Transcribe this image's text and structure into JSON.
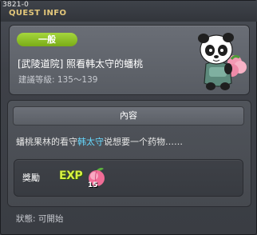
{
  "window": {
    "id_label": "3821-0",
    "title": "QUEST INFO"
  },
  "quest": {
    "badge": "一般",
    "name": "[武陵道院] 照看韩太守的蟠桃",
    "level": "建議等級: 135～139"
  },
  "content": {
    "header": "內容",
    "description_before": "蟠桃果林的看守",
    "npc_name": "韩太守",
    "description_after": "说想要一个药物……"
  },
  "reward": {
    "label": "獎勵",
    "exp_icon_text": "EXP",
    "item_icon": "peach-icon",
    "item_quantity": "15"
  },
  "status": "狀態: 可開始",
  "colors": {
    "badge": "#8bbf26",
    "title": "#e3c77a",
    "npc_highlight": "#66d9ff"
  }
}
